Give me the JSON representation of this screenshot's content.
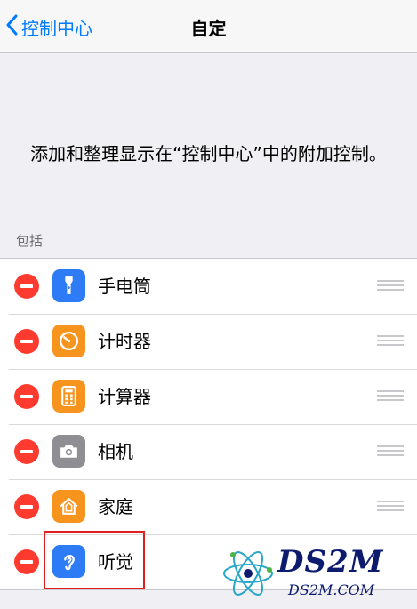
{
  "nav": {
    "back_label": "控制中心",
    "title": "自定"
  },
  "description": "添加和整理显示在“控制中心”中的附加控制。",
  "section_header": "包括",
  "controls": [
    {
      "label": "手电筒",
      "icon": "flashlight-icon",
      "color": "#2d7cf6"
    },
    {
      "label": "计时器",
      "icon": "timer-icon",
      "color": "#f7941d"
    },
    {
      "label": "计算器",
      "icon": "calculator-icon",
      "color": "#f7941d"
    },
    {
      "label": "相机",
      "icon": "camera-icon",
      "color": "#8e8e93"
    },
    {
      "label": "家庭",
      "icon": "home-icon",
      "color": "#f7941d"
    },
    {
      "label": "听觉",
      "icon": "ear-icon",
      "color": "#2d7cf6"
    }
  ],
  "watermark": {
    "brand": "DS2M",
    "site": "DS2M.COM"
  },
  "colors": {
    "accent": "#007aff",
    "remove": "#ff3b30",
    "highlight": "#e02020"
  }
}
